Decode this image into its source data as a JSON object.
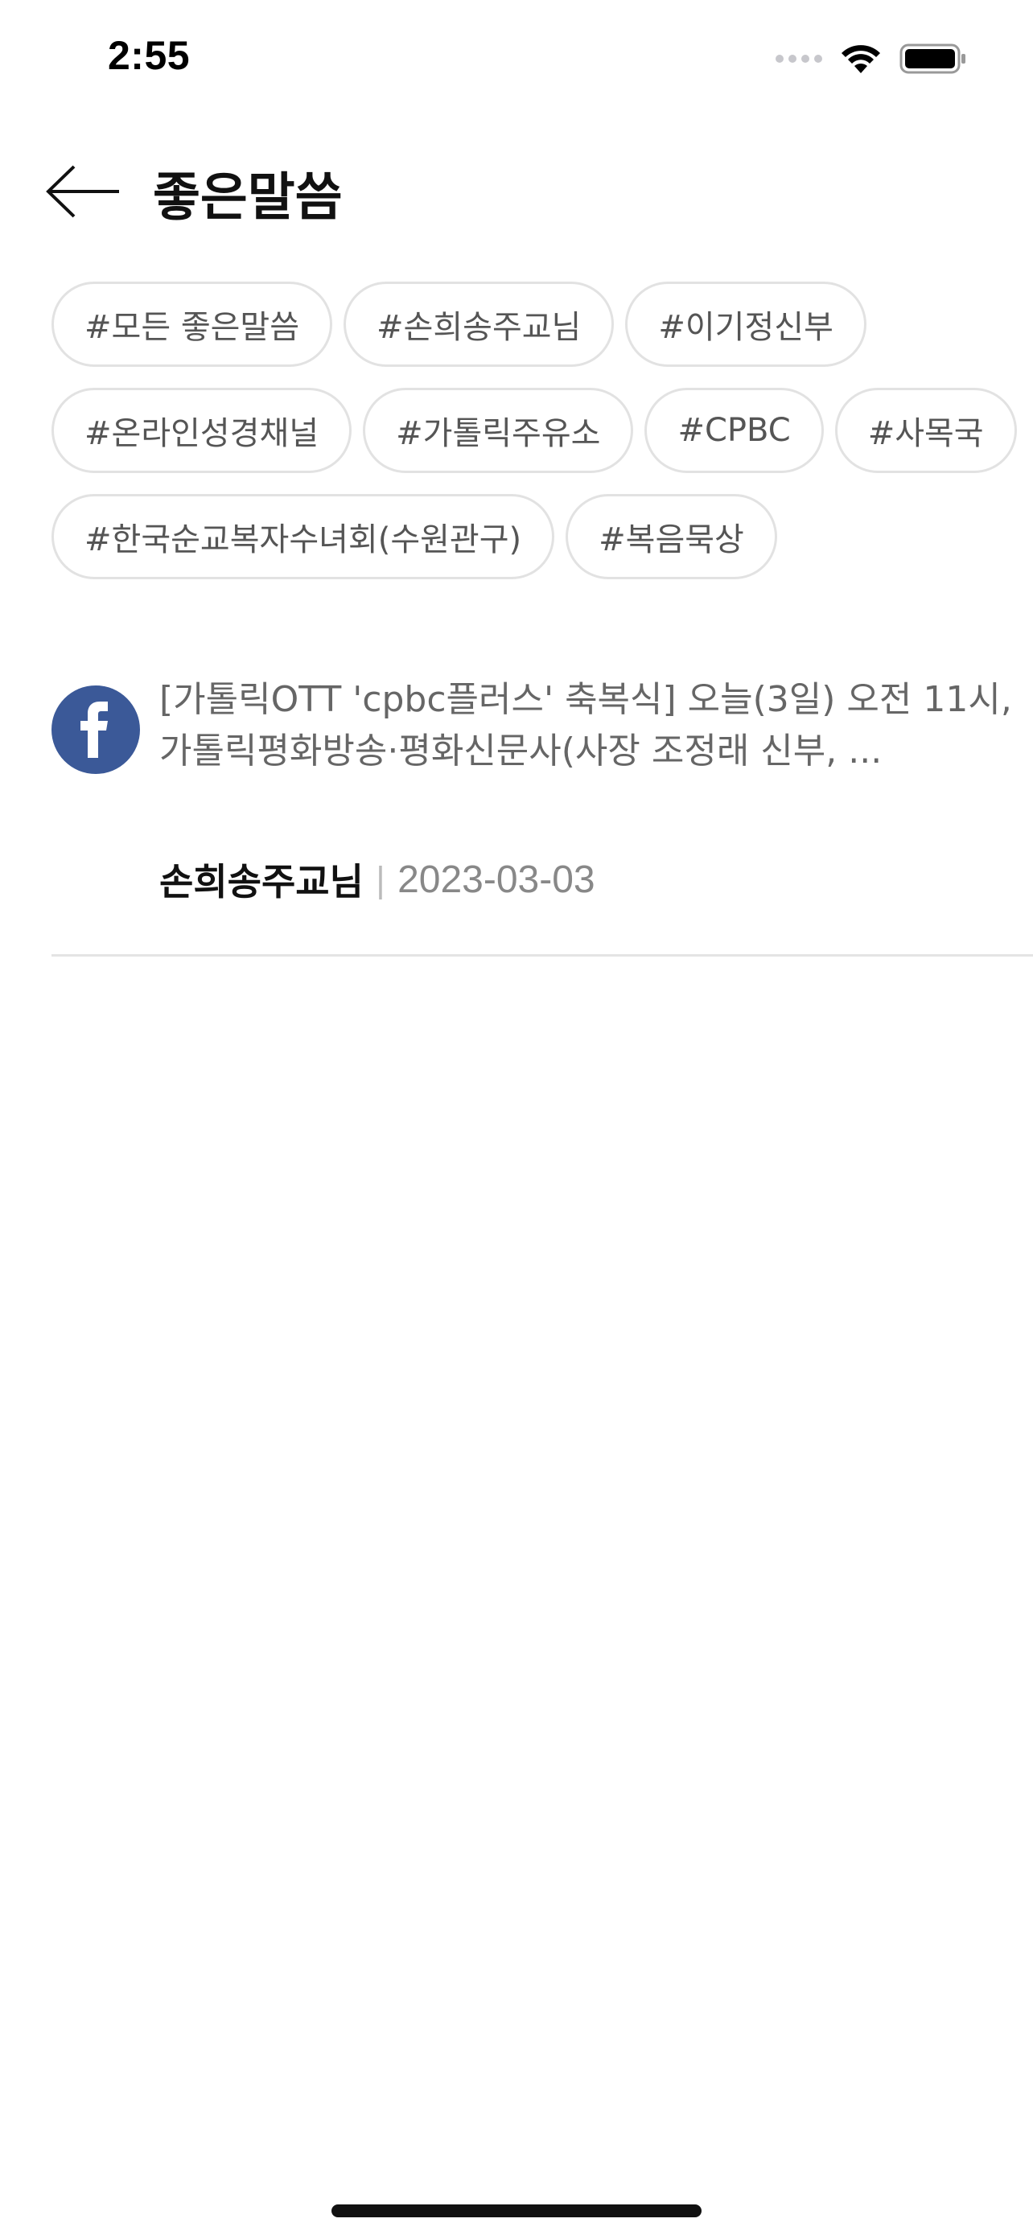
{
  "status_bar": {
    "time": "2:55"
  },
  "header": {
    "title": "좋은말씀"
  },
  "tags": [
    {
      "label": "#모든 좋은말씀"
    },
    {
      "label": "#손희송주교님"
    },
    {
      "label": "#이기정신부"
    },
    {
      "label": "#온라인성경채널"
    },
    {
      "label": "#가톨릭주유소"
    },
    {
      "label": "#CPBC"
    },
    {
      "label": "#사목국"
    },
    {
      "label": "#한국순교복자수녀회(수원관구)"
    },
    {
      "label": "#복음묵상"
    }
  ],
  "posts": [
    {
      "source_icon": "facebook-icon",
      "text": "[가톨릭OTT 'cpbc플러스' 축복식] 오늘(3일) 오전 11시, 가톨릭평화방송·평화신문사(사장 조정래 신부, ...",
      "author": "손희송주교님",
      "separator": "|",
      "date": "2023-03-03"
    }
  ],
  "colors": {
    "facebook": "#3b5998",
    "tag_border": "#e2e2e2",
    "divider": "#e4e4e4"
  }
}
